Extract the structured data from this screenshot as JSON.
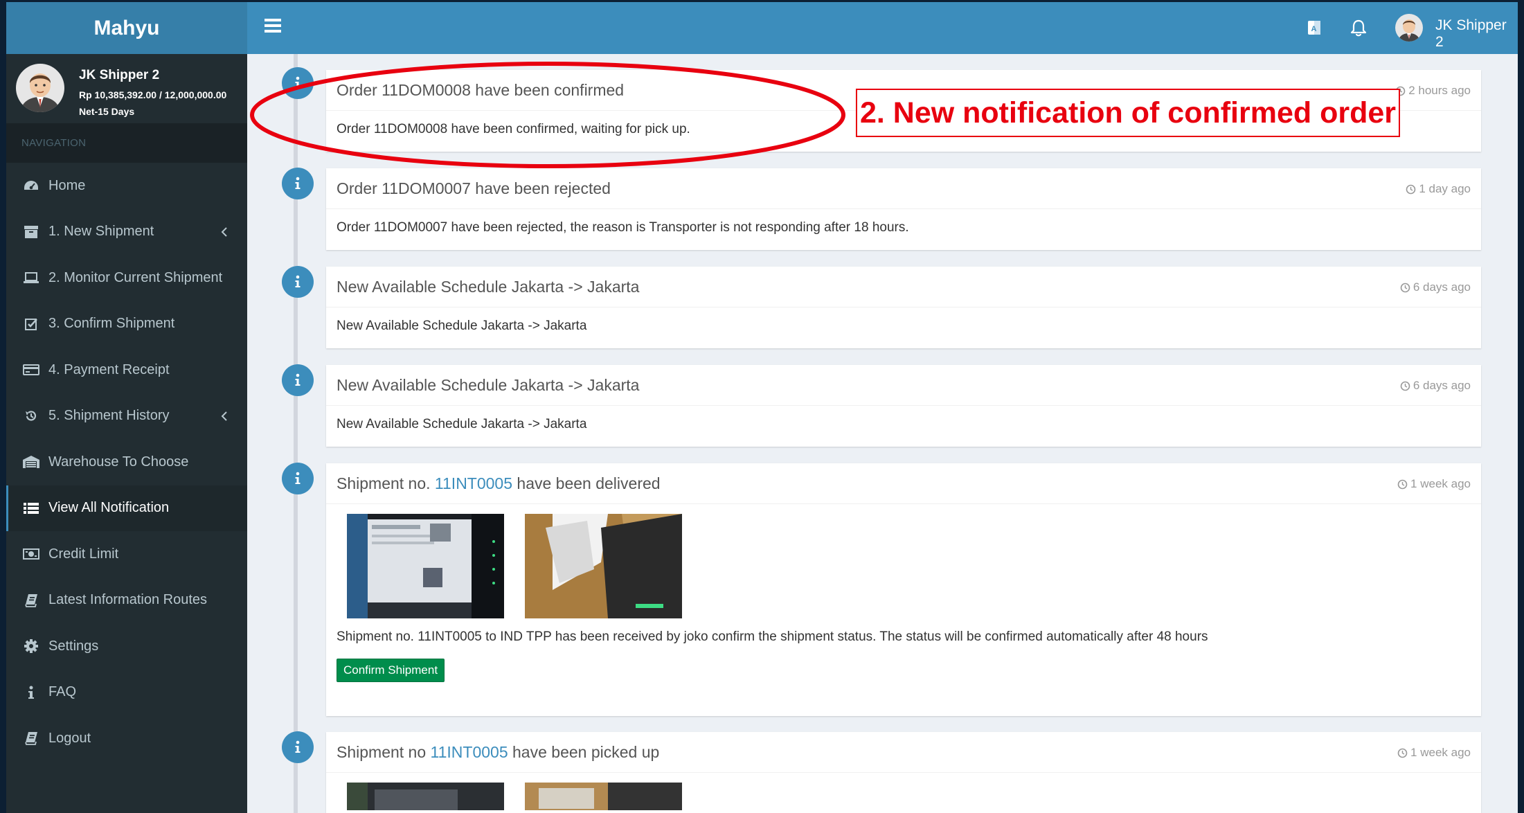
{
  "app": {
    "logo": "Mahyu"
  },
  "topbar": {
    "user_name": "JK Shipper 2"
  },
  "user_panel": {
    "name": "JK Shipper 2",
    "credit": "Rp 10,385,392.00 / 12,000,000.00",
    "terms": "Net-15 Days"
  },
  "sidebar": {
    "header": "NAVIGATION",
    "items": [
      {
        "label": "Home",
        "icon": "dashboard-icon"
      },
      {
        "label": "1. New Shipment",
        "icon": "archive-icon",
        "has_submenu": true
      },
      {
        "label": "2. Monitor Current Shipment",
        "icon": "laptop-icon"
      },
      {
        "label": "3. Confirm Shipment",
        "icon": "check-square-icon"
      },
      {
        "label": "4. Payment Receipt",
        "icon": "credit-card-icon"
      },
      {
        "label": "5. Shipment History",
        "icon": "history-icon",
        "has_submenu": true
      },
      {
        "label": "Warehouse To Choose",
        "icon": "warehouse-icon"
      },
      {
        "label": "View All Notification",
        "icon": "list-icon",
        "active": true
      },
      {
        "label": "Credit Limit",
        "icon": "money-icon"
      },
      {
        "label": "Latest Information Routes",
        "icon": "book-icon"
      },
      {
        "label": "Settings",
        "icon": "gear-icon"
      },
      {
        "label": "FAQ",
        "icon": "info-icon"
      },
      {
        "label": "Logout",
        "icon": "book-icon"
      }
    ]
  },
  "notifications": [
    {
      "title": "Order 11DOM0008 have been confirmed",
      "time": "2 hours ago",
      "body": "Order 11DOM0008 have been confirmed, waiting for pick up."
    },
    {
      "title": "Order 11DOM0007 have been rejected",
      "time": "1 day ago",
      "body": "Order 11DOM0007 have been rejected, the reason is Transporter is not responding after 18 hours."
    },
    {
      "title": "New Available Schedule Jakarta -> Jakarta",
      "time": "6 days ago",
      "body": "New Available Schedule Jakarta -> Jakarta"
    },
    {
      "title": "New Available Schedule Jakarta -> Jakarta",
      "time": "6 days ago",
      "body": "New Available Schedule Jakarta -> Jakarta"
    },
    {
      "title_prefix": "Shipment no.",
      "link": "11INT0005",
      "title_suffix": "have been delivered",
      "time": "1 week ago",
      "body": "Shipment no. 11INT0005 to IND TPP has been received by joko confirm the shipment status. The status will be confirmed automatically after 48 hours",
      "button": "Confirm Shipment"
    },
    {
      "title_prefix": "Shipment no",
      "link": "11INT0005",
      "title_suffix": "have been picked up",
      "time": "1 week ago"
    }
  ],
  "annotation": {
    "label": "2. New notification of confirmed order",
    "color": "#e8000f"
  },
  "colors": {
    "header": "#3c8dbc",
    "logo_bg": "#367fa9",
    "sidebar_bg": "#222d32",
    "content_bg": "#ecf0f5",
    "success": "#008d4c"
  }
}
